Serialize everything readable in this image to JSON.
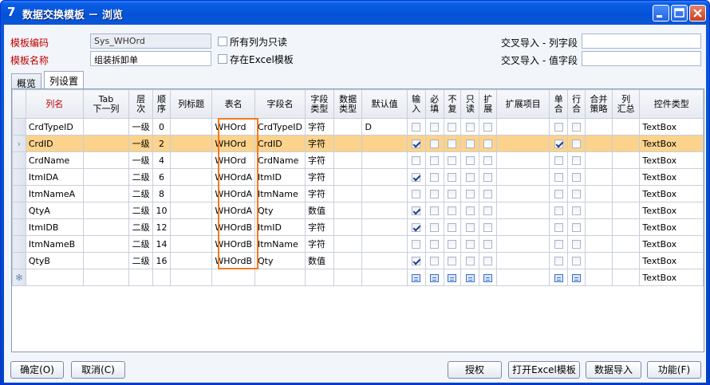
{
  "window": {
    "title": "数据交换模板 － 浏览",
    "app_icon": "7"
  },
  "form": {
    "code_label": "模板编码",
    "code_value": "Sys_WHOrd",
    "name_label": "模板名称",
    "name_value": "组装拆卸单",
    "readonly_label": "所有列为只读",
    "excel_label": "存在Excel模板",
    "cross_col_label": "交叉导入 - 列字段",
    "cross_val_label": "交叉导入 - 值字段",
    "cross_col_value": "",
    "cross_val_value": ""
  },
  "tabs": [
    {
      "label": "概览",
      "active": false
    },
    {
      "label": "列设置",
      "active": true
    }
  ],
  "grid": {
    "headers": [
      "列名",
      "Tab\n下一列",
      "层\n次",
      "顺\n序",
      "列标题",
      "表名",
      "字段名",
      "字段\n类型",
      "数据\n类型",
      "默认值",
      "输\n入",
      "必\n填",
      "不\n复",
      "只\n读",
      "扩\n展",
      "扩展项目",
      "单\n合",
      "行\n合",
      "合并\n策略",
      "列\n汇总",
      "控件类型"
    ],
    "rows": [
      {
        "name": "CrdTypeID",
        "level": "一级",
        "order": "0",
        "table": "WHOrd",
        "field": "CrdTypeID",
        "ftype": "字符",
        "default": "D",
        "input": false,
        "single": false,
        "control": "TextBox",
        "selected": false
      },
      {
        "name": "CrdID",
        "level": "一级",
        "order": "2",
        "table": "WHOrd",
        "field": "CrdID",
        "ftype": "字符",
        "default": "",
        "input": true,
        "single": true,
        "control": "TextBox",
        "selected": true
      },
      {
        "name": "CrdName",
        "level": "一级",
        "order": "4",
        "table": "WHOrd",
        "field": "CrdName",
        "ftype": "字符",
        "default": "",
        "input": false,
        "single": false,
        "control": "TextBox",
        "selected": false
      },
      {
        "name": "ItmIDA",
        "level": "二级",
        "order": "6",
        "table": "WHOrdA",
        "field": "ItmID",
        "ftype": "字符",
        "default": "",
        "input": true,
        "single": false,
        "control": "TextBox",
        "selected": false
      },
      {
        "name": "ItmNameA",
        "level": "二级",
        "order": "8",
        "table": "WHOrdA",
        "field": "ItmName",
        "ftype": "字符",
        "default": "",
        "input": false,
        "single": false,
        "control": "TextBox",
        "selected": false
      },
      {
        "name": "QtyA",
        "level": "二级",
        "order": "10",
        "table": "WHOrdA",
        "field": "Qty",
        "ftype": "数值",
        "default": "",
        "input": true,
        "single": false,
        "control": "TextBox",
        "selected": false
      },
      {
        "name": "ItmIDB",
        "level": "二级",
        "order": "12",
        "table": "WHOrdB",
        "field": "ItmID",
        "ftype": "字符",
        "default": "",
        "input": true,
        "single": false,
        "control": "TextBox",
        "selected": false
      },
      {
        "name": "ItmNameB",
        "level": "二级",
        "order": "14",
        "table": "WHOrdB",
        "field": "ItmName",
        "ftype": "字符",
        "default": "",
        "input": false,
        "single": false,
        "control": "TextBox",
        "selected": false
      },
      {
        "name": "QtyB",
        "level": "二级",
        "order": "16",
        "table": "WHOrdB",
        "field": "Qty",
        "ftype": "数值",
        "default": "",
        "input": true,
        "single": false,
        "control": "TextBox",
        "selected": false
      }
    ],
    "new_row_control": "TextBox"
  },
  "buttons": {
    "ok": "确定(O)",
    "cancel": "取消(C)",
    "grant": "授权",
    "open_excel": "打开Excel模板",
    "import": "数据导入",
    "function": "功能(F)"
  },
  "colors": {
    "title_bar": "#0453d6",
    "selected_row": "#fbd38d",
    "highlight_box": "#f07c1e",
    "label_red": "#c00000"
  }
}
